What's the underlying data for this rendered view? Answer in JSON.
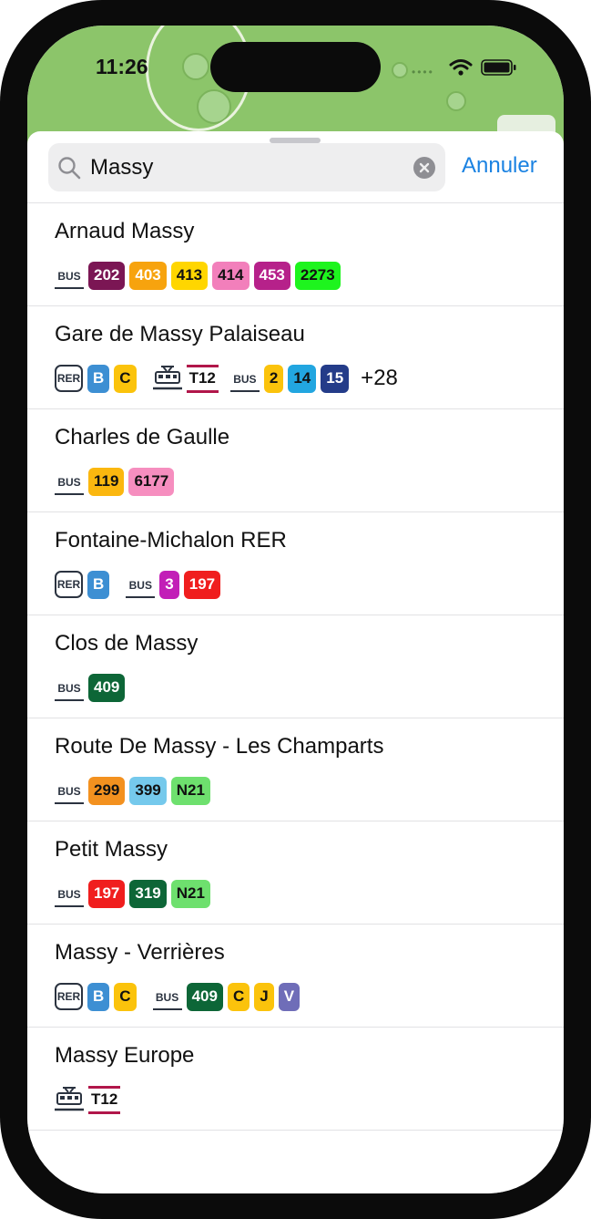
{
  "status_bar": {
    "time": "11:26",
    "signal": "••••"
  },
  "search": {
    "value": "Massy",
    "cancel_label": "Annuler"
  },
  "colors": {
    "accent": "#1a82e2",
    "tram_stripe": "#b1164a"
  },
  "results": [
    {
      "name": "Arnaud Massy",
      "groups": [
        {
          "mode": "BUS",
          "badges": [
            {
              "label": "202",
              "bg": "#7b1654",
              "fg": "#ffffff"
            },
            {
              "label": "403",
              "bg": "#f7a30e",
              "fg": "#ffffff"
            },
            {
              "label": "413",
              "bg": "#ffd600",
              "fg": "#111111"
            },
            {
              "label": "414",
              "bg": "#f27fbb",
              "fg": "#111111"
            },
            {
              "label": "453",
              "bg": "#b6218a",
              "fg": "#ffffff"
            },
            {
              "label": "2273",
              "bg": "#1ef41e",
              "fg": "#111111"
            }
          ]
        }
      ]
    },
    {
      "name": "Gare de Massy Palaiseau",
      "more": "+28",
      "groups": [
        {
          "mode": "RER",
          "badges": [
            {
              "label": "B",
              "bg": "#3d8fd3",
              "fg": "#ffffff"
            },
            {
              "label": "C",
              "bg": "#fbc30c",
              "fg": "#111111"
            }
          ]
        },
        {
          "mode": "TRAM",
          "badges": [
            {
              "label": "T12",
              "style": "tram"
            }
          ]
        },
        {
          "mode": "BUS",
          "badges": [
            {
              "label": "2",
              "bg": "#fbc30c",
              "fg": "#111111"
            },
            {
              "label": "14",
              "bg": "#22a6e0",
              "fg": "#111111"
            },
            {
              "label": "15",
              "bg": "#243c89",
              "fg": "#ffffff"
            }
          ]
        }
      ]
    },
    {
      "name": "Charles de Gaulle",
      "groups": [
        {
          "mode": "BUS",
          "badges": [
            {
              "label": "119",
              "bg": "#fbb70f",
              "fg": "#111111"
            },
            {
              "label": "6177",
              "bg": "#f68ebf",
              "fg": "#111111"
            }
          ]
        }
      ]
    },
    {
      "name": "Fontaine-Michalon RER",
      "groups": [
        {
          "mode": "RER",
          "badges": [
            {
              "label": "B",
              "bg": "#3d8fd3",
              "fg": "#ffffff"
            }
          ]
        },
        {
          "mode": "BUS",
          "badges": [
            {
              "label": "3",
              "bg": "#c21fb7",
              "fg": "#ffffff"
            },
            {
              "label": "197",
              "bg": "#f01e1e",
              "fg": "#ffffff"
            }
          ]
        }
      ]
    },
    {
      "name": "Clos de Massy",
      "groups": [
        {
          "mode": "BUS",
          "badges": [
            {
              "label": "409",
              "bg": "#0d6637",
              "fg": "#ffffff"
            }
          ]
        }
      ]
    },
    {
      "name": "Route De Massy - Les Champarts",
      "groups": [
        {
          "mode": "BUS",
          "badges": [
            {
              "label": "299",
              "bg": "#f3911f",
              "fg": "#111111"
            },
            {
              "label": "399",
              "bg": "#75c9ec",
              "fg": "#111111"
            },
            {
              "label": "N21",
              "bg": "#6ee06e",
              "fg": "#111111"
            }
          ]
        }
      ]
    },
    {
      "name": "Petit Massy",
      "groups": [
        {
          "mode": "BUS",
          "badges": [
            {
              "label": "197",
              "bg": "#f01e1e",
              "fg": "#ffffff"
            },
            {
              "label": "319",
              "bg": "#0d6637",
              "fg": "#ffffff"
            },
            {
              "label": "N21",
              "bg": "#6ee06e",
              "fg": "#111111"
            }
          ]
        }
      ]
    },
    {
      "name": "Massy - Verrières",
      "groups": [
        {
          "mode": "RER",
          "badges": [
            {
              "label": "B",
              "bg": "#3d8fd3",
              "fg": "#ffffff"
            },
            {
              "label": "C",
              "bg": "#fbc30c",
              "fg": "#111111"
            }
          ]
        },
        {
          "mode": "BUS",
          "badges": [
            {
              "label": "409",
              "bg": "#0d6637",
              "fg": "#ffffff"
            },
            {
              "label": "C",
              "bg": "#fbc30c",
              "fg": "#111111"
            },
            {
              "label": "J",
              "bg": "#fbc30c",
              "fg": "#111111"
            },
            {
              "label": "V",
              "bg": "#6f6db8",
              "fg": "#ffffff"
            }
          ]
        }
      ]
    },
    {
      "name": "Massy Europe",
      "groups": [
        {
          "mode": "TRAM",
          "badges": [
            {
              "label": "T12",
              "style": "tram"
            }
          ]
        }
      ]
    }
  ]
}
